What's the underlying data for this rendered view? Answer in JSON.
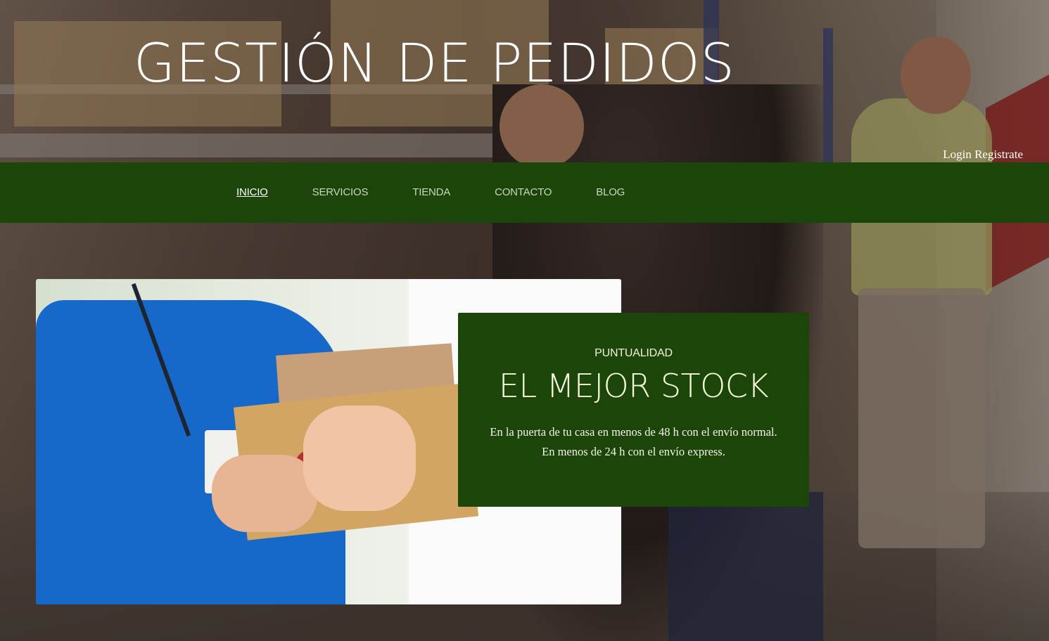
{
  "header": {
    "site_title": "GESTIÓN DE PEDIDOS",
    "login_label": "Login",
    "register_label": "Registrate"
  },
  "nav": {
    "items": [
      {
        "label": "INICIO",
        "active": true
      },
      {
        "label": "SERVICIOS",
        "active": false
      },
      {
        "label": "TIENDA",
        "active": false
      },
      {
        "label": "CONTACTO",
        "active": false
      },
      {
        "label": "BLOG",
        "active": false
      }
    ]
  },
  "hero": {
    "eyebrow": "PUNTUALIDAD",
    "heading": "EL MEJOR STOCK",
    "description": "En la puerta de tu casa en menos de 48 h con el envío normal. En menos de 24 h con el envío express."
  },
  "colors": {
    "brand_green": "#1c4509",
    "nav_text": "#c9d7bf",
    "card_text": "#f3f5e2"
  }
}
